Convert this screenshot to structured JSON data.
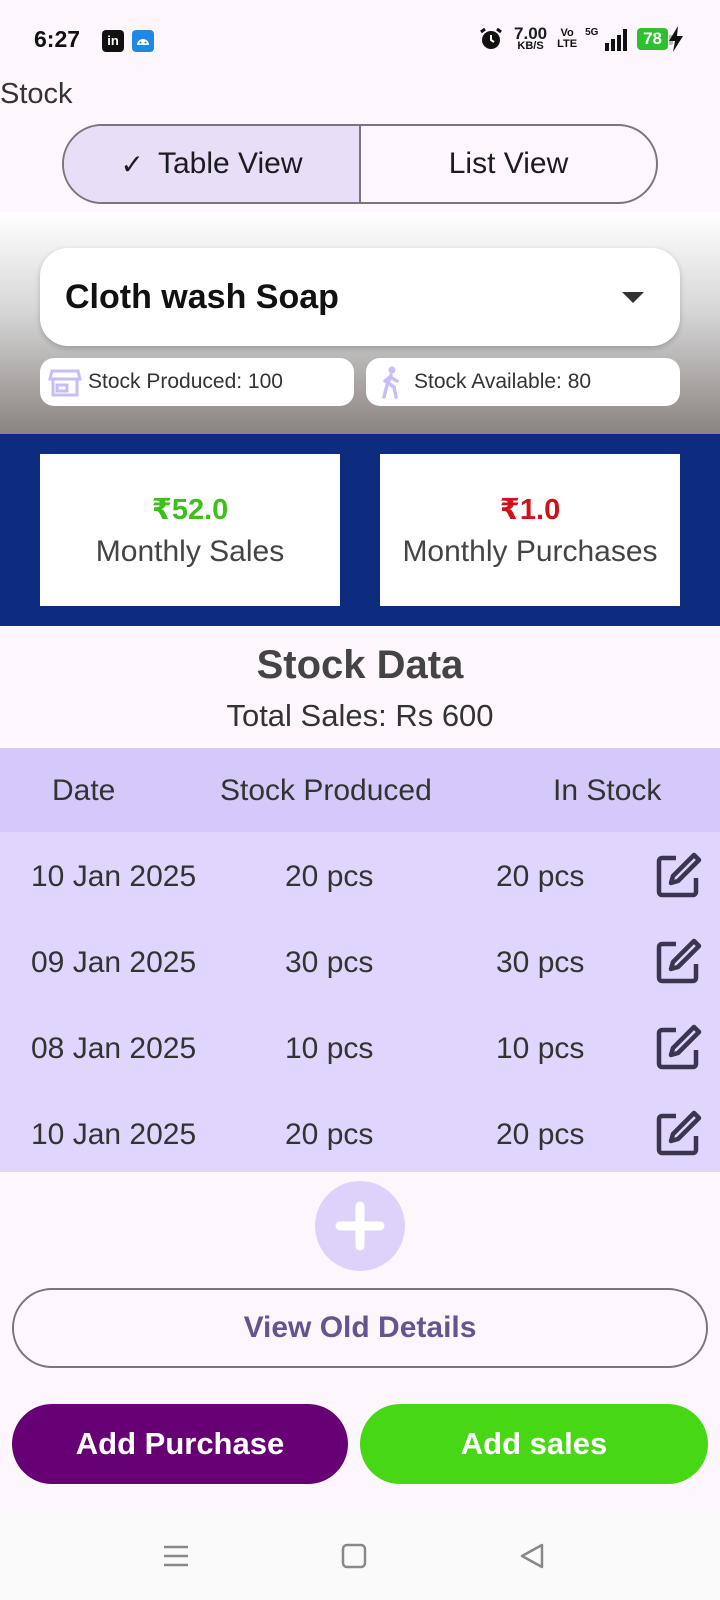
{
  "status_bar": {
    "time": "6:27",
    "speed_value": "7.00",
    "speed_unit": "KB/S",
    "volte_top": "Vo",
    "volte_bottom": "LTE",
    "network": "5G",
    "battery": "78"
  },
  "page": {
    "title": "Stock"
  },
  "view_toggle": {
    "table_label": "Table View",
    "list_label": "List View",
    "selected": "Table View"
  },
  "product": {
    "selected_name": "Cloth wash Soap",
    "stock_produced": "Stock Produced: 100",
    "stock_available": "Stock Available: 80"
  },
  "summary": {
    "sales_value": "₹52.0",
    "sales_label": "Monthly Sales",
    "purchases_value": "₹1.0",
    "purchases_label": "Monthly Purchases"
  },
  "stock_data": {
    "title": "Stock Data",
    "total_sales": "Total Sales: Rs 600",
    "columns": [
      "Date",
      "Stock Produced",
      "In Stock"
    ],
    "rows": [
      {
        "date": "10 Jan 2025",
        "produced": "20 pcs",
        "in_stock": "20 pcs"
      },
      {
        "date": "09 Jan 2025",
        "produced": "30 pcs",
        "in_stock": "30 pcs"
      },
      {
        "date": "08 Jan 2025",
        "produced": "10 pcs",
        "in_stock": "10 pcs"
      },
      {
        "date": "10 Jan 2025",
        "produced": "20 pcs",
        "in_stock": "20 pcs"
      }
    ]
  },
  "actions": {
    "view_old": "View Old Details",
    "add_purchase": "Add Purchase",
    "add_sales": "Add sales"
  },
  "colors": {
    "summary_band": "#0d2c80",
    "sales_green": "#3bc11a",
    "purchase_red": "#d0101a",
    "purchase_button": "#680075",
    "sales_button": "#48d715"
  }
}
